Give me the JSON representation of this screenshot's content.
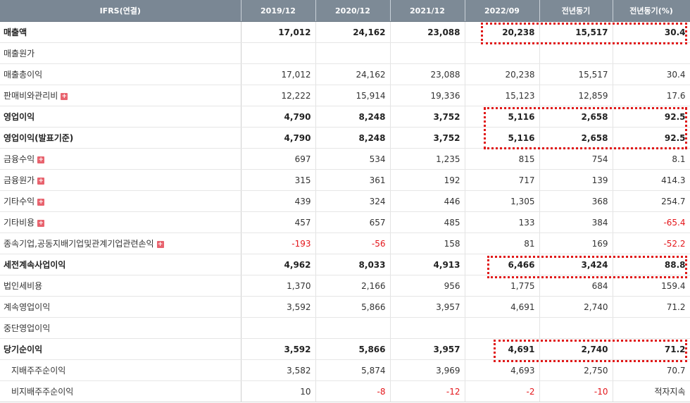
{
  "header": [
    "IFRS(연결)",
    "2019/12",
    "2020/12",
    "2021/12",
    "2022/09",
    "전년동기",
    "전년동기(%)"
  ],
  "rows": [
    {
      "name": "매출액",
      "bold": true,
      "expand": false,
      "indent": false,
      "values": [
        "17,012",
        "24,162",
        "23,088",
        "20,238",
        "15,517",
        "30.4"
      ]
    },
    {
      "name": "매출원가",
      "bold": false,
      "expand": false,
      "indent": false,
      "values": [
        "",
        "",
        "",
        "",
        "",
        ""
      ]
    },
    {
      "name": "매출총이익",
      "bold": false,
      "expand": false,
      "indent": false,
      "values": [
        "17,012",
        "24,162",
        "23,088",
        "20,238",
        "15,517",
        "30.4"
      ]
    },
    {
      "name": "판매비와관리비",
      "bold": false,
      "expand": true,
      "indent": false,
      "values": [
        "12,222",
        "15,914",
        "19,336",
        "15,123",
        "12,859",
        "17.6"
      ]
    },
    {
      "name": "영업이익",
      "bold": true,
      "expand": false,
      "indent": false,
      "values": [
        "4,790",
        "8,248",
        "3,752",
        "5,116",
        "2,658",
        "92.5"
      ]
    },
    {
      "name": "영업이익(발표기준)",
      "bold": true,
      "expand": false,
      "indent": false,
      "values": [
        "4,790",
        "8,248",
        "3,752",
        "5,116",
        "2,658",
        "92.5"
      ]
    },
    {
      "name": "금융수익",
      "bold": false,
      "expand": true,
      "indent": false,
      "values": [
        "697",
        "534",
        "1,235",
        "815",
        "754",
        "8.1"
      ]
    },
    {
      "name": "금융원가",
      "bold": false,
      "expand": true,
      "indent": false,
      "values": [
        "315",
        "361",
        "192",
        "717",
        "139",
        "414.3"
      ]
    },
    {
      "name": "기타수익",
      "bold": false,
      "expand": true,
      "indent": false,
      "values": [
        "439",
        "324",
        "446",
        "1,305",
        "368",
        "254.7"
      ]
    },
    {
      "name": "기타비용",
      "bold": false,
      "expand": true,
      "indent": false,
      "values": [
        "457",
        "657",
        "485",
        "133",
        "384",
        "-65.4"
      ]
    },
    {
      "name": "종속기업,공동지배기업및관계기업관련손익",
      "bold": false,
      "expand": true,
      "indent": false,
      "values": [
        "-193",
        "-56",
        "158",
        "81",
        "169",
        "-52.2"
      ]
    },
    {
      "name": "세전계속사업이익",
      "bold": true,
      "expand": false,
      "indent": false,
      "values": [
        "4,962",
        "8,033",
        "4,913",
        "6,466",
        "3,424",
        "88.8"
      ]
    },
    {
      "name": "법인세비용",
      "bold": false,
      "expand": false,
      "indent": false,
      "values": [
        "1,370",
        "2,166",
        "956",
        "1,775",
        "684",
        "159.4"
      ]
    },
    {
      "name": "계속영업이익",
      "bold": false,
      "expand": false,
      "indent": false,
      "values": [
        "3,592",
        "5,866",
        "3,957",
        "4,691",
        "2,740",
        "71.2"
      ]
    },
    {
      "name": "중단영업이익",
      "bold": false,
      "expand": false,
      "indent": false,
      "values": [
        "",
        "",
        "",
        "",
        "",
        ""
      ]
    },
    {
      "name": "당기순이익",
      "bold": true,
      "expand": false,
      "indent": false,
      "values": [
        "3,592",
        "5,866",
        "3,957",
        "4,691",
        "2,740",
        "71.2"
      ]
    },
    {
      "name": "지배주주순이익",
      "bold": false,
      "expand": false,
      "indent": true,
      "values": [
        "3,582",
        "5,874",
        "3,969",
        "4,693",
        "2,750",
        "70.7"
      ]
    },
    {
      "name": "비지배주주순이익",
      "bold": false,
      "expand": false,
      "indent": true,
      "values": [
        "10",
        "-8",
        "-12",
        "-2",
        "-10",
        "적자지속"
      ]
    }
  ],
  "negative_color": "#e4161b",
  "highlight_color": "#e01818",
  "expand_icon": "plus-square-icon"
}
